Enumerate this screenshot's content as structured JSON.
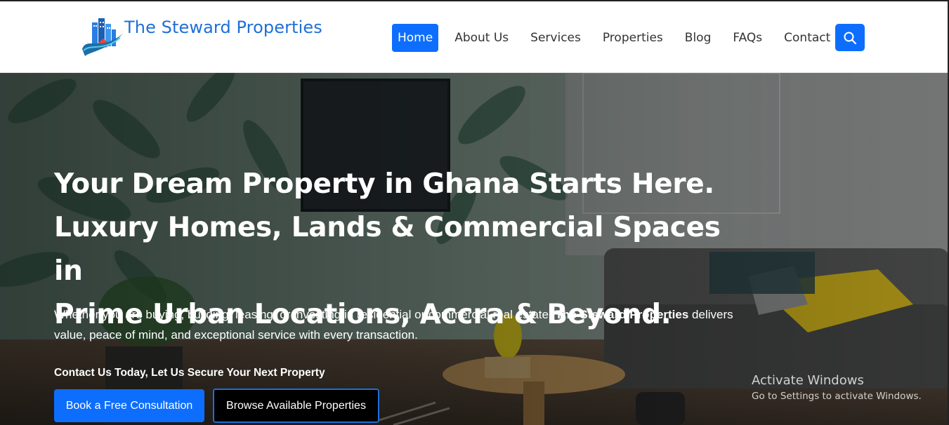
{
  "brand": {
    "name": "The Steward Properties",
    "logo_icon": "buildings-swoosh-logo",
    "color": "#1e6fd8"
  },
  "nav": {
    "items": [
      {
        "label": "Home",
        "active": true
      },
      {
        "label": "About Us",
        "active": false
      },
      {
        "label": "Services",
        "active": false
      },
      {
        "label": "Properties",
        "active": false
      },
      {
        "label": "Blog",
        "active": false
      },
      {
        "label": "FAQs",
        "active": false
      },
      {
        "label": "Contact",
        "active": false
      }
    ],
    "search_icon": "search-icon",
    "accent": "#0d6efd"
  },
  "hero": {
    "title_line1": "Your Dream Property in Ghana Starts Here.",
    "title_line2": "Luxury Homes, Lands & Commercial Spaces in",
    "title_line3": "Prime Urban Locations, Accra & Beyond.",
    "desc_before": "Whether you are buying, building, leasing, or investing in residential or commercial real estate, ",
    "desc_bold": "The Steward Properties",
    "desc_after": " delivers value, peace of mind, and exceptional service with every transaction.",
    "cta_label": "Contact Us Today, Let Us Secure Your Next Property",
    "btn_primary": "Book a Free Consultation",
    "btn_secondary": "Browse Available Properties"
  },
  "watermark": {
    "line1": "Activate Windows",
    "line2": "Go to Settings to activate Windows."
  }
}
